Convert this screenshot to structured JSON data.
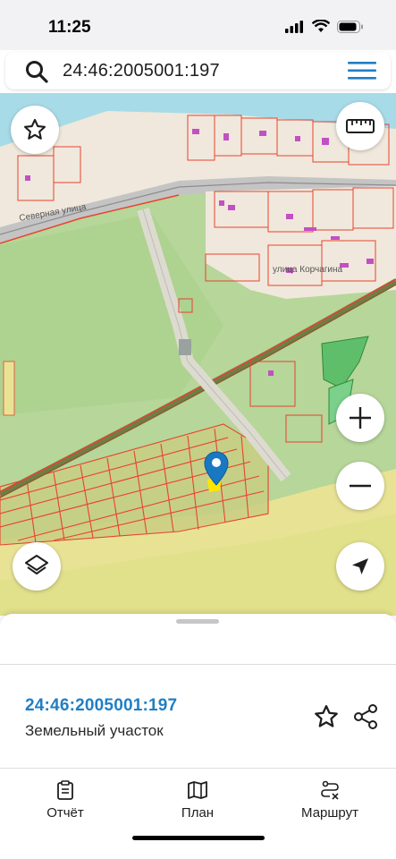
{
  "status": {
    "time": "11:25"
  },
  "search": {
    "query": "24:46:2005001:197"
  },
  "map": {
    "street_1": "Северная улица",
    "street_2": "улица Корчагина",
    "colors": {
      "forest": "#b6d69a",
      "water": "#a8dbe8",
      "urban": "#f0e8dc",
      "parcel_line": "#e8432e",
      "building": "#c34fc4",
      "fields": "#e8e394",
      "road": "#9a9a9a",
      "railway": "#8b5a2b"
    }
  },
  "sheet": {
    "cadastral_number": "24:46:2005001:197",
    "object_type": "Земельный участок"
  },
  "tabs": [
    {
      "label": "Отчёт",
      "icon": "clipboard-icon"
    },
    {
      "label": "План",
      "icon": "map-icon"
    },
    {
      "label": "Маршрут",
      "icon": "route-icon"
    }
  ],
  "accent_color": "#1f7fc5"
}
